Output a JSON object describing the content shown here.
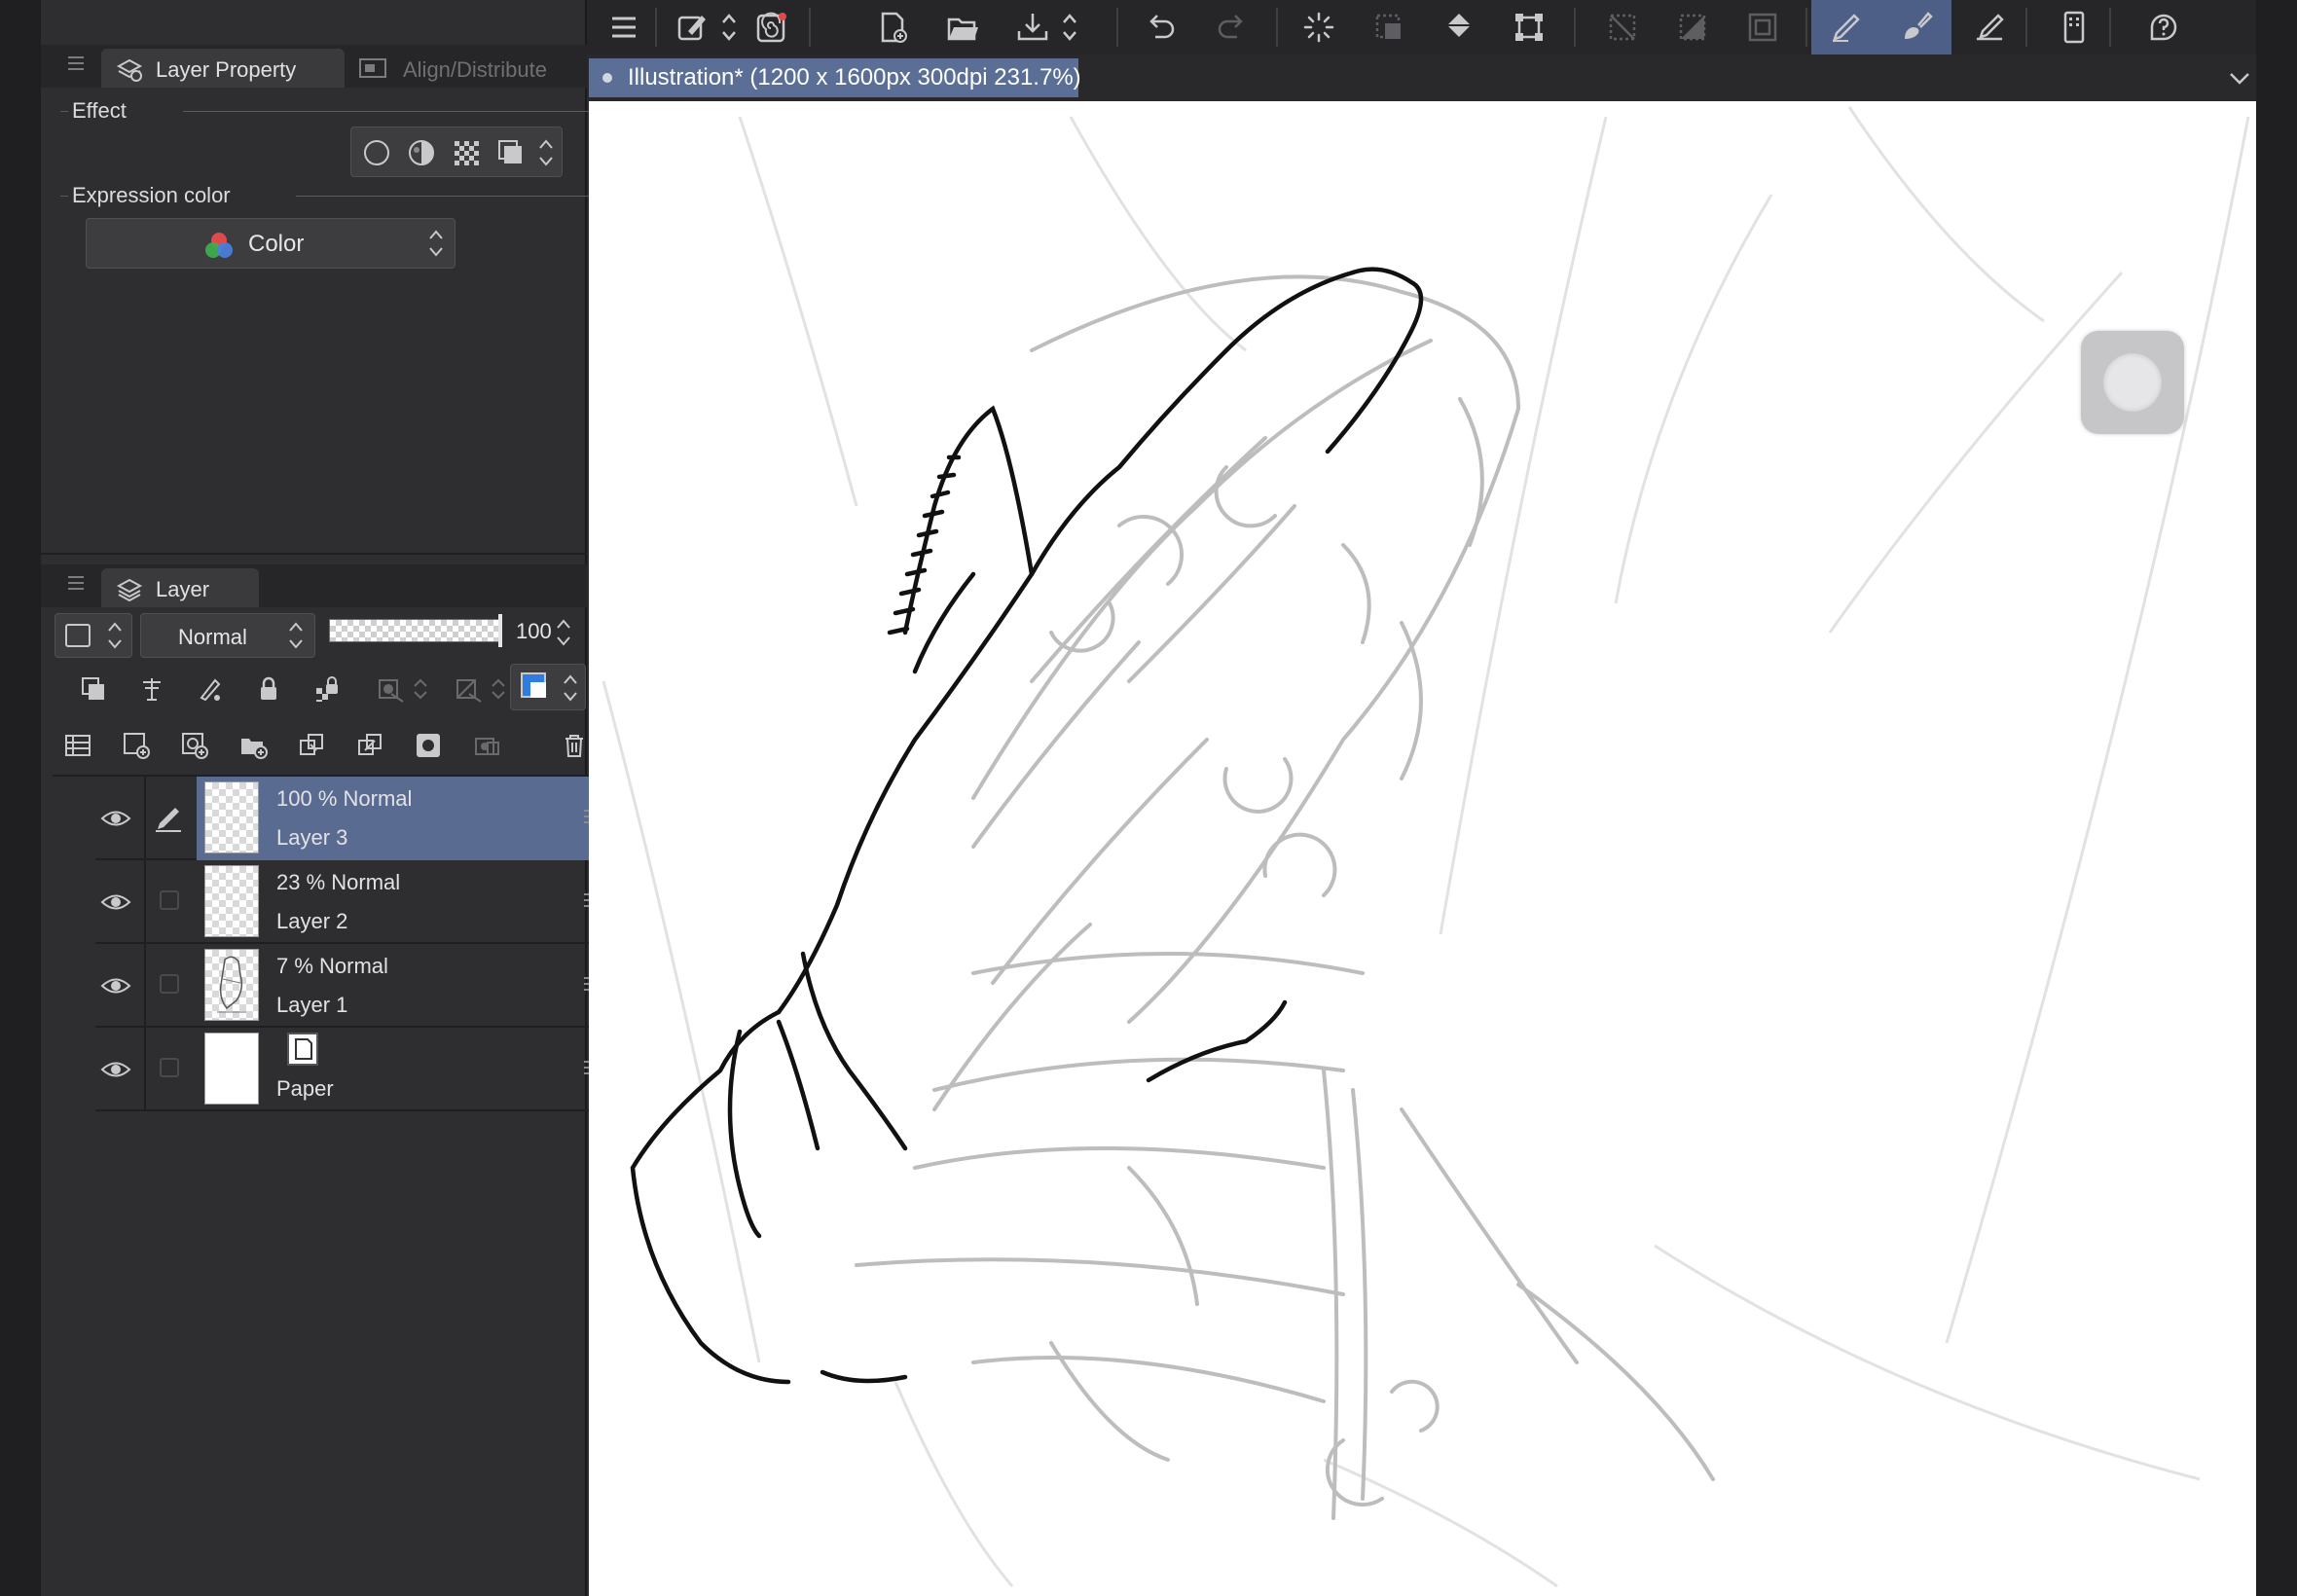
{
  "colors": {
    "accent": "#5a6b91",
    "active_tool": "#4d5f86",
    "panel_bg": "#2e2e30",
    "canvas": "#ffffff"
  },
  "toolbar": {
    "icons": [
      "menu-icon",
      "pen-settings-icon",
      "expand-arrows-icon",
      "spiral-icon",
      "new-canvas-icon",
      "open-folder-icon",
      "save-icon",
      "expand-arrows-icon",
      "undo-icon",
      "redo-icon",
      "loading-spinner-icon",
      "select-frame-icon",
      "fill-bucket-icon",
      "transform-icon",
      "deselect-icon",
      "invert-selection-icon",
      "selection-border-icon",
      "pen-tool-icon",
      "brush-tool-icon",
      "eraser-tool-icon",
      "device-icon",
      "help-icon"
    ]
  },
  "document_tab": {
    "title": "Illustration* (1200 x 1600px 300dpi 231.7%)"
  },
  "layer_property": {
    "tab_label": "Layer Property",
    "second_tab_label": "Align/Distribute",
    "effect_label": "Effect",
    "expression_color_label": "Expression color",
    "expression_color_value": "Color"
  },
  "layer_panel": {
    "title": "Layer",
    "blend_mode": "Normal",
    "opacity": "100",
    "layers": [
      {
        "line1": "100 % Normal",
        "line2": "Layer 3",
        "selected": true
      },
      {
        "line1": "23 % Normal",
        "line2": "Layer 2",
        "selected": false
      },
      {
        "line1": "7 % Normal",
        "line2": "Layer 1",
        "selected": false
      },
      {
        "line1": "",
        "line2": "Paper",
        "selected": false
      }
    ]
  }
}
